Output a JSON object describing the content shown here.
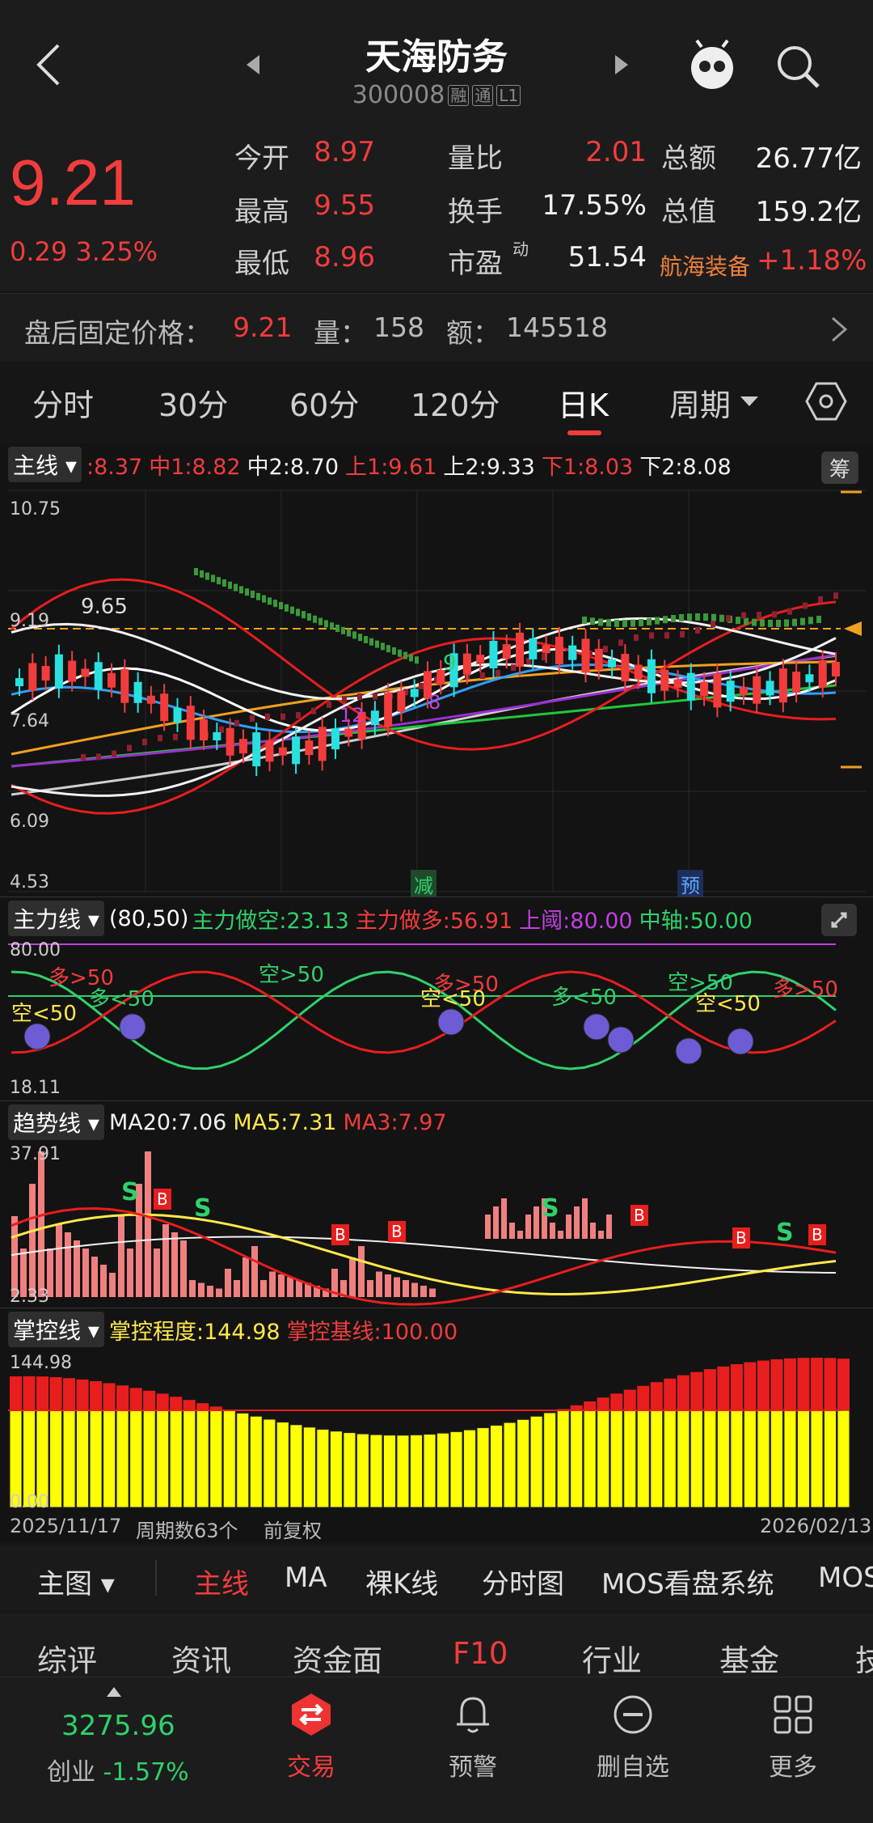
{
  "header": {
    "title": "天海防务",
    "code": "300008",
    "tags": [
      "融",
      "通",
      "L1"
    ]
  },
  "quote": {
    "price": "9.21",
    "change": "0.29",
    "change_pct": "3.25%",
    "fields": [
      {
        "label": "今开",
        "value": "8.97",
        "color": "#f23c3c"
      },
      {
        "label": "量比",
        "value": "2.01",
        "color": "#f23c3c"
      },
      {
        "label": "总额",
        "value": "26.77亿",
        "color": "#f2f2f2"
      },
      {
        "label": "最高",
        "value": "9.55",
        "color": "#f23c3c"
      },
      {
        "label": "换手",
        "value": "17.55%",
        "color": "#f2f2f2"
      },
      {
        "label": "总值",
        "value": "159.2亿",
        "color": "#f2f2f2"
      },
      {
        "label": "最低",
        "value": "8.96",
        "color": "#f23c3c"
      },
      {
        "label": "市盈",
        "value": "51.54",
        "color": "#f2f2f2"
      }
    ],
    "pe_sup": "动",
    "sector_name": "航海装备",
    "sector_change": "+1.18%"
  },
  "afterhours": {
    "label": "盘后固定价格：",
    "price": "9.21",
    "vol_label": "量：",
    "vol": "158",
    "amt_label": "额：",
    "amt": "145518"
  },
  "periods": {
    "tabs": [
      "分时",
      "30分",
      "60分",
      "120分",
      "日K",
      "周期"
    ],
    "active": "日K"
  },
  "main_chart": {
    "selector": "主线",
    "legend": [
      {
        "text": ":8.37",
        "color": "#f23c3c"
      },
      {
        "text": "中1:8.82",
        "color": "#f23c3c"
      },
      {
        "text": "中2:8.70",
        "color": "#f2f2f2"
      },
      {
        "text": "上1:9.61",
        "color": "#f23c3c"
      },
      {
        "text": "上2:9.33",
        "color": "#f2f2f2"
      },
      {
        "text": "下1:8.03",
        "color": "#f23c3c"
      },
      {
        "text": "下2:8.08",
        "color": "#f2f2f2"
      }
    ],
    "chip_button": "筹",
    "y_labels": [
      "10.75",
      "9.19",
      "7.64",
      "6.09",
      "4.53"
    ],
    "max_label": "9.65",
    "signal_9": "9",
    "signal_8": "8",
    "signal_12": "12",
    "tag_jian": "减",
    "tag_yu": "预"
  },
  "ind1": {
    "selector": "主力线",
    "params": "(80,50)",
    "legend": [
      {
        "text": "主力做空:23.13",
        "color": "#2fd16b"
      },
      {
        "text": "主力做多:56.91",
        "color": "#f23c3c"
      },
      {
        "text": "上阈:80.00",
        "color": "#c040e0"
      },
      {
        "text": "中轴:50.00",
        "color": "#2fd16b"
      }
    ],
    "y_top": "80.00",
    "y_bot": "18.11",
    "labels": [
      {
        "text": "多>50",
        "color": "#f23c3c"
      },
      {
        "text": "多<50",
        "color": "#2fd16b"
      },
      {
        "text": "空<50",
        "color": "#ffe94a"
      },
      {
        "text": "空>50",
        "color": "#2fd16b"
      },
      {
        "text": "多>50",
        "color": "#f23c3c"
      },
      {
        "text": "空<50",
        "color": "#ffe94a"
      },
      {
        "text": "多<50",
        "color": "#2fd16b"
      },
      {
        "text": "空>50",
        "color": "#2fd16b"
      },
      {
        "text": "空<50",
        "color": "#ffe94a"
      },
      {
        "text": "多>50",
        "color": "#f23c3c"
      }
    ]
  },
  "ind2": {
    "selector": "趋势线",
    "legend": [
      {
        "text": "MA20:7.06",
        "color": "#f2f2f2"
      },
      {
        "text": "MA5:7.31",
        "color": "#ffe94a"
      },
      {
        "text": "MA3:7.97",
        "color": "#f23c3c"
      }
    ],
    "y_top": "37.91",
    "y_bot": "2.33",
    "s": "S",
    "b": "B"
  },
  "ind3": {
    "selector": "掌控线",
    "legend": [
      {
        "text": "掌控程度:144.98",
        "color": "#ffe94a"
      },
      {
        "text": "掌控基线:100.00",
        "color": "#f23c3c"
      }
    ],
    "y_top": "144.98",
    "y_bot": "0.00"
  },
  "footer_info": {
    "start_date": "2025/11/17",
    "period_count": "周期数63个",
    "adjust": "前复权",
    "end_date": "2026/02/13"
  },
  "subtabs": {
    "main_btn": "主图",
    "items": [
      "主线",
      "MA",
      "裸K线",
      "分时图",
      "MOS看盘系统",
      "MOS"
    ]
  },
  "f10tabs": {
    "items": [
      "综评",
      "资讯",
      "资金面",
      "F10",
      "行业",
      "基金",
      "技"
    ]
  },
  "bottom": {
    "index_value": "3275.96",
    "index_name": "创业",
    "index_change": "-1.57%",
    "nav": [
      {
        "label": "交易",
        "icon": "trade-icon"
      },
      {
        "label": "预警",
        "icon": "bell-icon"
      },
      {
        "label": "删自选",
        "icon": "minus-circle-icon"
      },
      {
        "label": "更多",
        "icon": "grid-icon"
      }
    ]
  }
}
